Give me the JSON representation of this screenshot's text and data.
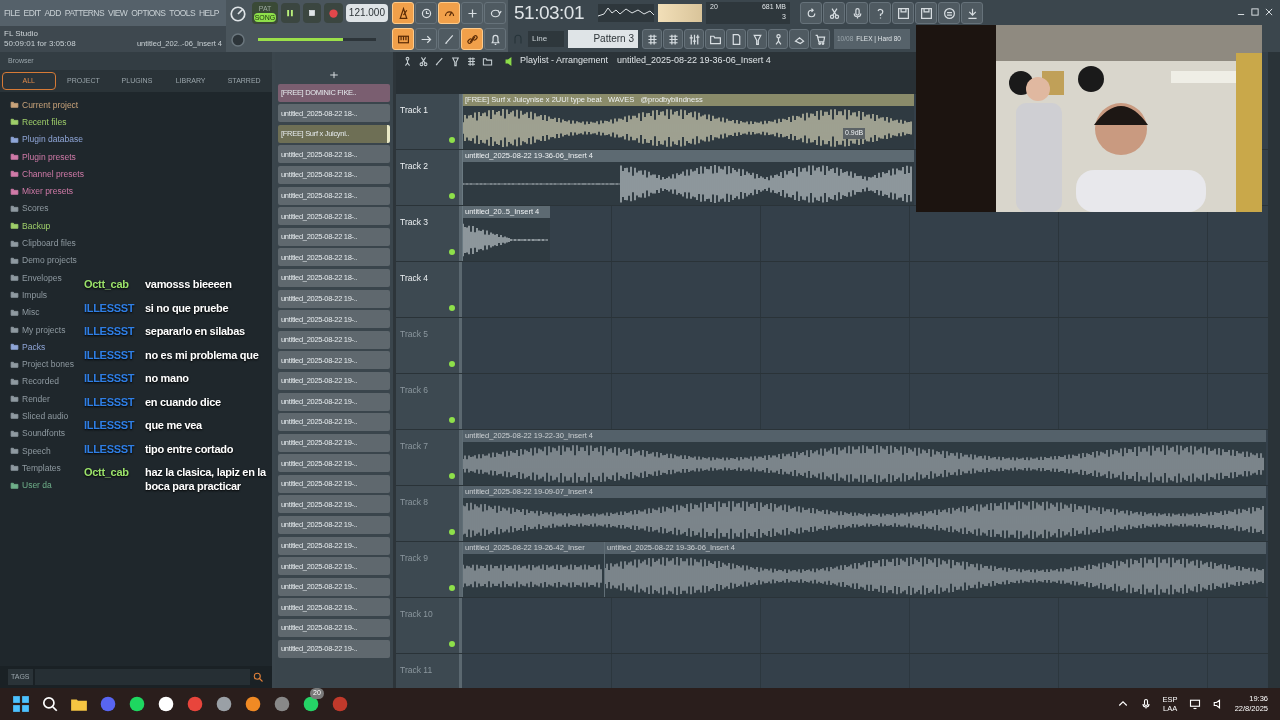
{
  "menu": [
    "FILE",
    "EDIT",
    "ADD",
    "PATTERNS",
    "VIEW",
    "OPTIONS",
    "TOOLS",
    "HELP"
  ],
  "transport": {
    "pat_label": "PAT",
    "song_label": "SONG",
    "song_mode": true,
    "tempo": "121.000",
    "time": "51:03:01",
    "cpu": "20",
    "memory": "681 MB",
    "polyphony": "3"
  },
  "toggles_top": [
    {
      "kind": "metronome",
      "on": true
    },
    {
      "kind": "clock",
      "on": false
    },
    {
      "kind": "gauge",
      "on": true
    },
    {
      "kind": "step",
      "on": false
    },
    {
      "kind": "loop",
      "on": false
    }
  ],
  "toggles_bottom": [
    {
      "kind": "keyboard",
      "on": true
    },
    {
      "kind": "arrow",
      "on": false
    },
    {
      "kind": "brush",
      "on": false
    },
    {
      "kind": "link",
      "on": true
    },
    {
      "kind": "bell",
      "on": false
    }
  ],
  "hint_bar": {
    "title": "FL Studio",
    "info": "50:09:01 for 3:05:08",
    "file": "untitled_202..-06_Insert 4"
  },
  "master_volume": {
    "level": 0.72
  },
  "snap": "Line",
  "pattern": "Pattern 3",
  "news": {
    "date": "10/08",
    "text": "FLEX | Hard 80"
  },
  "browser": {
    "title": "Browser",
    "tabs": [
      {
        "label": "ALL",
        "selected": true
      },
      {
        "label": "PROJECT",
        "selected": false
      },
      {
        "label": "PLUGINS",
        "selected": false
      },
      {
        "label": "LIBRARY",
        "selected": false
      },
      {
        "label": "STARRED",
        "selected": false
      }
    ],
    "items": [
      {
        "label": "Current project",
        "color": "#c9a37a"
      },
      {
        "label": "Recent files",
        "color": "#9fcf6a"
      },
      {
        "label": "Plugin database",
        "color": "#8fa6d8"
      },
      {
        "label": "Plugin presets",
        "color": "#d07aa8"
      },
      {
        "label": "Channel presets",
        "color": "#d07aa8"
      },
      {
        "label": "Mixer presets",
        "color": "#d07aa8"
      },
      {
        "label": "Scores",
        "color": "#8f9aa1"
      },
      {
        "label": "Backup",
        "color": "#9fcf6a"
      },
      {
        "label": "Clipboard files",
        "color": "#8f9aa1"
      },
      {
        "label": "Demo projects",
        "color": "#8f9aa1"
      },
      {
        "label": "Envelopes",
        "color": "#8f9aa1"
      },
      {
        "label": "Impuls",
        "color": "#8f9aa1"
      },
      {
        "label": "Misc",
        "color": "#8f9aa1"
      },
      {
        "label": "My projects",
        "color": "#8f9aa1"
      },
      {
        "label": "Packs",
        "color": "#8fa6d8"
      },
      {
        "label": "Project bones",
        "color": "#8f9aa1"
      },
      {
        "label": "Recorded",
        "color": "#8f9aa1"
      },
      {
        "label": "Render",
        "color": "#8f9aa1"
      },
      {
        "label": "Sliced audio",
        "color": "#8f9aa1"
      },
      {
        "label": "Soundfonts",
        "color": "#8f9aa1"
      },
      {
        "label": "Speech",
        "color": "#8f9aa1"
      },
      {
        "label": "Templates",
        "color": "#8f9aa1"
      },
      {
        "label": "User da",
        "color": "#6fb08a"
      }
    ],
    "tags_label": "TAGS"
  },
  "clip_list": [
    {
      "label": "[FREE] DOMINIC FIKE..",
      "color": "#7a5e70",
      "selected": false
    },
    {
      "label": "untitled_2025-08-22 18-..",
      "color": "#5f686e",
      "selected": false
    },
    {
      "label": "[FREE] Surf x Juicyni..",
      "color": "#6e6f55",
      "selected": true
    },
    {
      "label": "untitled_2025-08-22 18-..",
      "color": "#5f686e",
      "selected": false
    },
    {
      "label": "untitled_2025-08-22 18-..",
      "color": "#5f686e",
      "selected": false
    },
    {
      "label": "untitled_2025-08-22 18-..",
      "color": "#5f686e",
      "selected": false
    },
    {
      "label": "untitled_2025-08-22 18-..",
      "color": "#5f686e",
      "selected": false
    },
    {
      "label": "untitled_2025-08-22 18-..",
      "color": "#5f686e",
      "selected": false
    },
    {
      "label": "untitled_2025-08-22 18-..",
      "color": "#5f686e",
      "selected": false
    },
    {
      "label": "untitled_2025-08-22 18-..",
      "color": "#5f686e",
      "selected": false
    },
    {
      "label": "untitled_2025-08-22 19-..",
      "color": "#5f686e",
      "selected": false
    },
    {
      "label": "untitled_2025-08-22 19-..",
      "color": "#5f686e",
      "selected": false
    },
    {
      "label": "untitled_2025-08-22 19-..",
      "color": "#5f686e",
      "selected": false
    },
    {
      "label": "untitled_2025-08-22 19-..",
      "color": "#5f686e",
      "selected": false
    },
    {
      "label": "untitled_2025-08-22 19-..",
      "color": "#5f686e",
      "selected": false
    },
    {
      "label": "untitled_2025-08-22 19-..",
      "color": "#5f686e",
      "selected": false
    },
    {
      "label": "untitled_2025-08-22 19-..",
      "color": "#5f686e",
      "selected": false
    },
    {
      "label": "untitled_2025-08-22 19-..",
      "color": "#5f686e",
      "selected": false
    },
    {
      "label": "untitled_2025-08-22 19-..",
      "color": "#5f686e",
      "selected": false
    },
    {
      "label": "untitled_2025-08-22 19-..",
      "color": "#5f686e",
      "selected": false
    },
    {
      "label": "untitled_2025-08-22 19-..",
      "color": "#5f686e",
      "selected": false
    },
    {
      "label": "untitled_2025-08-22 19-..",
      "color": "#5f686e",
      "selected": false
    },
    {
      "label": "untitled_2025-08-22 19-..",
      "color": "#5f686e",
      "selected": false
    },
    {
      "label": "untitled_2025-08-22 19-..",
      "color": "#5f686e",
      "selected": false
    },
    {
      "label": "untitled_2025-08-22 19-..",
      "color": "#5f686e",
      "selected": false
    },
    {
      "label": "untitled_2025-08-22 19-..",
      "color": "#5f686e",
      "selected": false
    },
    {
      "label": "untitled_2025-08-22 19-..",
      "color": "#5f686e",
      "selected": false
    },
    {
      "label": "untitled_2025-08-22 19-..",
      "color": "#5f686e",
      "selected": false
    }
  ],
  "playlist": {
    "title": "Playlist - Arrangement",
    "clip_name": "untitled_2025-08-22 19-36-06_Insert 4",
    "tracks": [
      {
        "label": "Track 1",
        "dimmed": false,
        "clips": [
          {
            "label": "[FREE] Surf x Juicynise x 2UU! type beat   WAVES   @prodbyblindness",
            "color": "#8a8b6a",
            "gain": "0.9dB"
          }
        ]
      },
      {
        "label": "Track 2",
        "dimmed": false,
        "clips": [
          {
            "label": "untitled_2025-08-22 19-36-06_Insert 4",
            "color": "#5d6a72"
          }
        ]
      },
      {
        "label": "Track 3",
        "dimmed": false,
        "clips": [
          {
            "label": "untitled_20..5_Insert 4",
            "color": "#5d6a72"
          }
        ]
      },
      {
        "label": "Track 4",
        "dimmed": false
      },
      {
        "label": "Track 5",
        "dimmed": true
      },
      {
        "label": "Track 6",
        "dimmed": true
      },
      {
        "label": "Track 7",
        "dimmed": true,
        "clips": [
          {
            "label": "untitled_2025-08-22 19-22-30_Insert 4",
            "color": "#5d6a72"
          }
        ]
      },
      {
        "label": "Track 8",
        "dimmed": true,
        "clips": [
          {
            "label": "untitled_2025-08-22 19-09-07_Insert 4",
            "color": "#5d6a72"
          }
        ]
      },
      {
        "label": "Track 9",
        "dimmed": true,
        "clips": [
          {
            "label": "untitled_2025-08-22 19-26-42_Inser",
            "color": "#5d6a72"
          },
          {
            "label": "untitled_2025-08-22 19-36-06_Insert 4",
            "color": "#5d6a72"
          }
        ]
      },
      {
        "label": "Track 10",
        "dimmed": true
      },
      {
        "label": "Track 11",
        "dimmed": true
      }
    ]
  },
  "chat": [
    {
      "user": "Octt_cab",
      "color": "#9be26a",
      "message": "vamosss bieeeen"
    },
    {
      "user": "ILLESSST",
      "color": "#2f7fe6",
      "message": "si no que pruebe"
    },
    {
      "user": "ILLESSST",
      "color": "#2f7fe6",
      "message": "separarlo en silabas"
    },
    {
      "user": "ILLESSST",
      "color": "#2f7fe6",
      "message": "no es mi problema que"
    },
    {
      "user": "ILLESSST",
      "color": "#2f7fe6",
      "message": "no mano"
    },
    {
      "user": "ILLESSST",
      "color": "#2f7fe6",
      "message": "en cuando dice"
    },
    {
      "user": "ILLESSST",
      "color": "#2f7fe6",
      "message": "que me vea"
    },
    {
      "user": "ILLESSST",
      "color": "#2f7fe6",
      "message": "tipo entre cortado"
    },
    {
      "user": "Octt_cab",
      "color": "#9be26a",
      "message": "haz la clasica, lapiz en la boca para practicar"
    }
  ],
  "webcam": {
    "kind": "picture"
  },
  "taskbar": {
    "badge": "20",
    "language": "ESP",
    "layout": "LAA",
    "time": "19:36",
    "date": "22/8/2025"
  }
}
